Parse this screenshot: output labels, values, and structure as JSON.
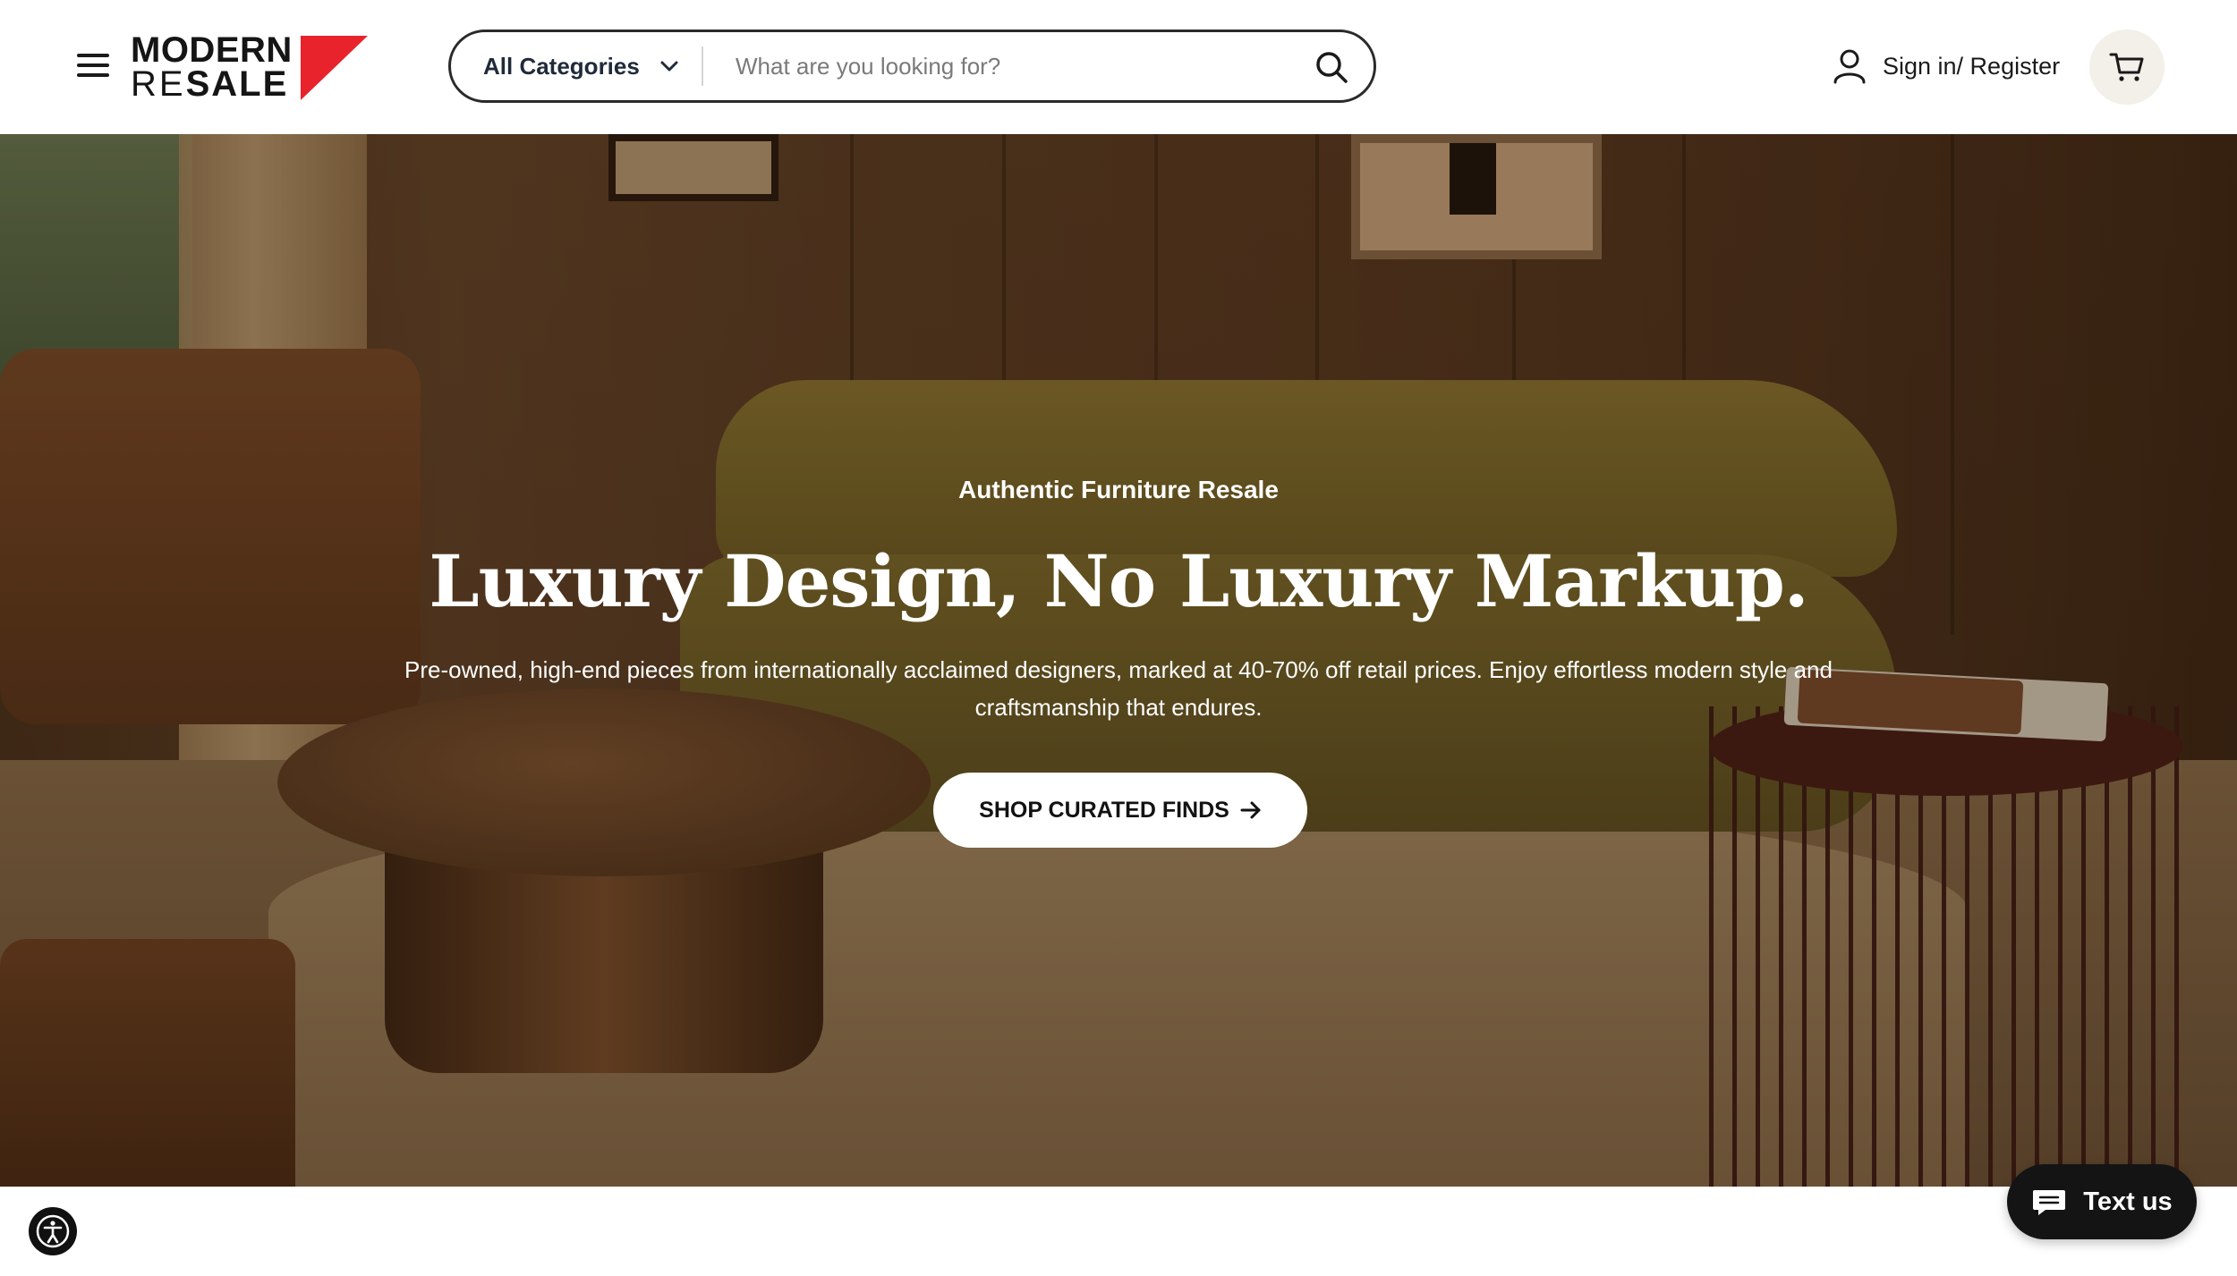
{
  "header": {
    "menu_icon": "hamburger-menu-icon",
    "logo": {
      "line1": "MODERN",
      "line2_re": "RE",
      "line2_sale": "SALE",
      "accent_color": "#e8232b"
    },
    "search": {
      "category_label": "All Categories",
      "placeholder": "What are you looking for?",
      "value": "",
      "search_icon": "search-icon"
    },
    "account": {
      "label": "Sign in/ Register",
      "icon": "user-icon"
    },
    "cart": {
      "icon": "cart-icon"
    }
  },
  "hero": {
    "eyebrow": "Authentic Furniture Resale",
    "headline": "Luxury Design, No Luxury Markup.",
    "subtext": "Pre-owned, high-end pieces from internationally acclaimed designers, marked at 40-70% off retail prices. Enjoy effortless modern style and craftsmanship that endures.",
    "cta_label": "SHOP CURATED FINDS",
    "cta_icon": "arrow-right-icon"
  },
  "floating": {
    "accessibility_icon": "accessibility-icon",
    "chat_label": "Text us",
    "chat_icon": "chat-bubble-icon"
  },
  "colors": {
    "brand_red": "#e8232b",
    "text_dark": "#1a1a1a",
    "cart_bg": "#f3efe9",
    "chat_bg": "#141414"
  }
}
